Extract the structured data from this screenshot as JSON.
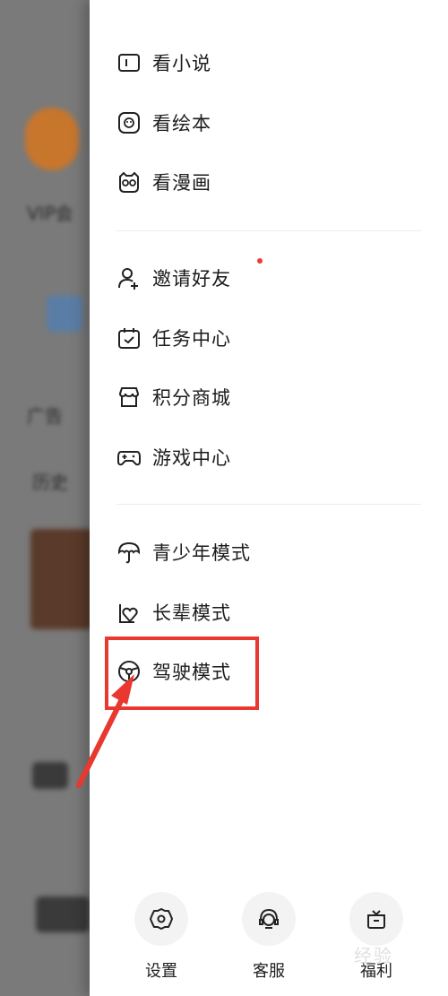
{
  "background_app": {
    "vip_text": "VIP会",
    "section_ad": "广告",
    "section_history": "历史"
  },
  "menu": {
    "group1": [
      {
        "label": "看小说",
        "icon": "book-icon",
        "hint": ""
      },
      {
        "label": "看绘本",
        "icon": "picture-book-icon",
        "hint": ""
      },
      {
        "label": "看漫画",
        "icon": "comic-icon",
        "hint": ""
      }
    ],
    "group2": [
      {
        "label": "邀请好友",
        "icon": "invite-friend-icon",
        "hint": ""
      },
      {
        "label": "任务中心",
        "icon": "task-calendar-icon",
        "hint": ""
      },
      {
        "label": "积分商城",
        "icon": "store-icon",
        "hint": ""
      },
      {
        "label": "游戏中心",
        "icon": "gamepad-icon",
        "hint": ""
      }
    ],
    "group3": [
      {
        "label": "青少年模式",
        "icon": "umbrella-icon"
      },
      {
        "label": "长辈模式",
        "icon": "heart-hand-icon"
      },
      {
        "label": "驾驶模式",
        "icon": "steering-wheel-icon"
      }
    ]
  },
  "bottom": {
    "settings": "设置",
    "service": "客服",
    "welfare": "福利"
  },
  "annotation": {
    "highlight_color": "#e8382f"
  },
  "watermark": "经验"
}
